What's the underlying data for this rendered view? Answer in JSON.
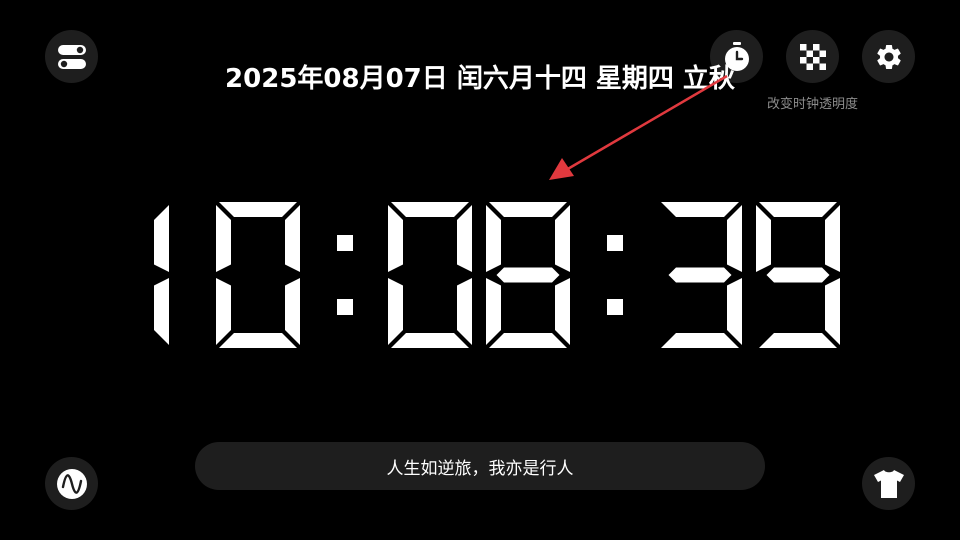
{
  "header": {
    "date_text": "2025年08月07日 闰六月十四 星期四 立秋",
    "tooltip": "改变时钟透明度"
  },
  "clock": {
    "time": "10:08:39",
    "hours": "10",
    "minutes": "08",
    "seconds": "39"
  },
  "quote": {
    "text": "人生如逆旅，我亦是行人"
  },
  "buttons": {
    "top_left": "toggle-icon",
    "timer": "stopwatch-icon",
    "opacity": "checkerboard-icon",
    "settings": "gear-icon",
    "bottom_left": "wave-icon",
    "bottom_right": "tshirt-icon"
  },
  "colors": {
    "background": "#000000",
    "button_bg": "#1e1e1e",
    "text": "#ffffff",
    "tooltip_text": "#8c8c8c",
    "arrow": "#e0393e"
  }
}
